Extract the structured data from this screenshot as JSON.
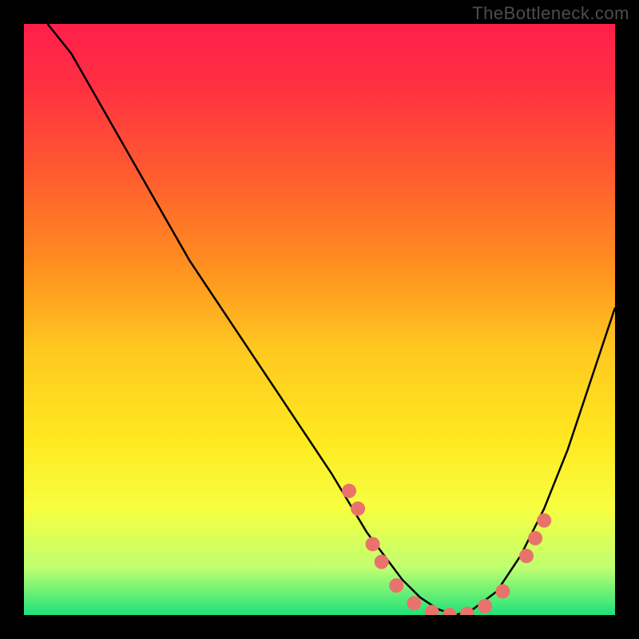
{
  "watermark": "TheBottleneck.com",
  "chart_data": {
    "type": "line",
    "title": "",
    "xlabel": "",
    "ylabel": "",
    "xlim": [
      0,
      100
    ],
    "ylim": [
      0,
      100
    ],
    "grid": false,
    "background_gradient": {
      "stops": [
        {
          "offset": 0.0,
          "color": "#ff1f4b"
        },
        {
          "offset": 0.1,
          "color": "#ff2f42"
        },
        {
          "offset": 0.25,
          "color": "#ff5a30"
        },
        {
          "offset": 0.4,
          "color": "#ff8c20"
        },
        {
          "offset": 0.55,
          "color": "#ffc820"
        },
        {
          "offset": 0.7,
          "color": "#ffe820"
        },
        {
          "offset": 0.82,
          "color": "#f7ff40"
        },
        {
          "offset": 0.92,
          "color": "#bfff70"
        },
        {
          "offset": 1.0,
          "color": "#1ee27a"
        }
      ]
    },
    "series": [
      {
        "name": "bottleneck-curve",
        "color": "#000000",
        "x": [
          4,
          8,
          12,
          16,
          20,
          24,
          28,
          32,
          36,
          40,
          44,
          48,
          52,
          55,
          58,
          61,
          64,
          67,
          70,
          73,
          76,
          80,
          84,
          88,
          92,
          96,
          100
        ],
        "y": [
          100,
          95,
          88,
          81,
          74,
          67,
          60,
          54,
          48,
          42,
          36,
          30,
          24,
          19,
          14,
          10,
          6,
          3,
          1,
          0,
          1,
          4,
          10,
          18,
          28,
          40,
          52
        ]
      }
    ],
    "scatter": {
      "name": "data-points",
      "color": "#e8736b",
      "radius": 9,
      "points": [
        {
          "x": 55,
          "y": 21
        },
        {
          "x": 56.5,
          "y": 18
        },
        {
          "x": 59,
          "y": 12
        },
        {
          "x": 60.5,
          "y": 9
        },
        {
          "x": 63,
          "y": 5
        },
        {
          "x": 66,
          "y": 2
        },
        {
          "x": 69,
          "y": 0.5
        },
        {
          "x": 72,
          "y": 0
        },
        {
          "x": 75,
          "y": 0.2
        },
        {
          "x": 78,
          "y": 1.5
        },
        {
          "x": 81,
          "y": 4
        },
        {
          "x": 85,
          "y": 10
        },
        {
          "x": 86.5,
          "y": 13
        },
        {
          "x": 88,
          "y": 16
        }
      ]
    }
  }
}
